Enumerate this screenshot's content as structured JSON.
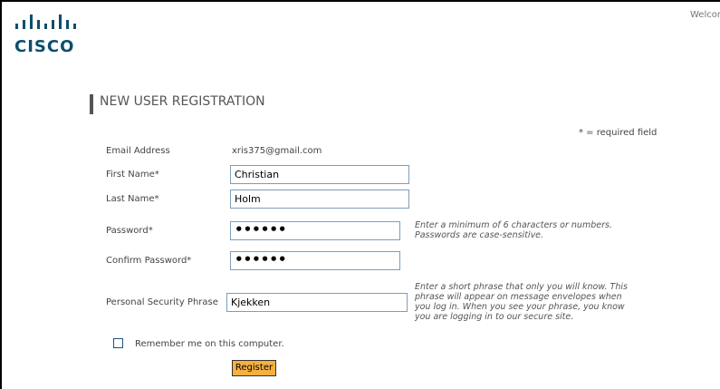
{
  "header": {
    "welcome": "Welcome",
    "logo_word": "CISCO"
  },
  "form": {
    "title": "NEW USER REGISTRATION",
    "required_note": "* = required field",
    "email": {
      "label": "Email Address",
      "value": "xris375@gmail.com"
    },
    "first_name": {
      "label": "First Name*",
      "value": "Christian"
    },
    "last_name": {
      "label": "Last Name*",
      "value": "Holm"
    },
    "password": {
      "label": "Password*",
      "value": "••••••",
      "hint_line1": "Enter a minimum of 6 characters or numbers.",
      "hint_line2": "Passwords are case-sensitive."
    },
    "confirm_password": {
      "label": "Confirm Password*",
      "value": "••••••"
    },
    "security_phrase": {
      "label": "Personal Security Phrase",
      "value": "Kjekken",
      "hint_line1": "Enter a short phrase that only you will know. This",
      "hint_line2": "phrase will appear on message envelopes when",
      "hint_line3": "you log in. When you see your phrase, you know",
      "hint_line4": "you are logging in to our secure site."
    },
    "remember_me": {
      "label": "Remember me on this computer.",
      "checked": false
    },
    "register_button": "Register"
  },
  "colors": {
    "logo": "#0b4f6c",
    "button": "#f4b13f",
    "input_border": "#7f9db9"
  }
}
